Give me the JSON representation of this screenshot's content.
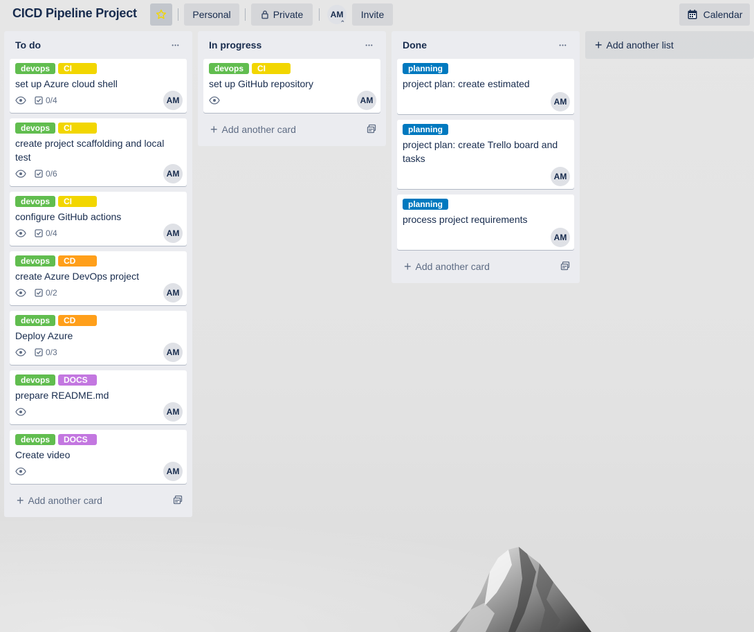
{
  "header": {
    "board_title": "CICD Pipeline Project",
    "personal": "Personal",
    "private": "Private",
    "avatar": "AM",
    "invite": "Invite",
    "calendar": "Calendar"
  },
  "colors": {
    "devops": "#61bd4f",
    "CI": "#f2d600",
    "CD": "#ff9f1a",
    "DOCS": "#c377e0",
    "planning": "#0079bf"
  },
  "lists": [
    {
      "title": "To do",
      "add_card": "Add another card",
      "cards": [
        {
          "labels": [
            "devops",
            "CI"
          ],
          "title": "set up Azure cloud shell",
          "checklist": "0/4",
          "member": "AM"
        },
        {
          "labels": [
            "devops",
            "CI"
          ],
          "title": "create project scaffolding and local test",
          "checklist": "0/6",
          "member": "AM"
        },
        {
          "labels": [
            "devops",
            "CI"
          ],
          "title": "configure GitHub actions",
          "checklist": "0/4",
          "member": "AM"
        },
        {
          "labels": [
            "devops",
            "CD"
          ],
          "title": "create Azure DevOps project",
          "checklist": "0/2",
          "member": "AM"
        },
        {
          "labels": [
            "devops",
            "CD"
          ],
          "title": "Deploy Azure",
          "checklist": "0/3",
          "member": "AM"
        },
        {
          "labels": [
            "devops",
            "DOCS"
          ],
          "title": "prepare README.md",
          "checklist": "",
          "member": "AM"
        },
        {
          "labels": [
            "devops",
            "DOCS"
          ],
          "title": "Create video",
          "checklist": "",
          "member": "AM"
        }
      ]
    },
    {
      "title": "In progress",
      "add_card": "Add another card",
      "cards": [
        {
          "labels": [
            "devops",
            "CI"
          ],
          "title": "set up GitHub repository",
          "checklist": "",
          "member": "AM"
        }
      ]
    },
    {
      "title": "Done",
      "add_card": "Add another card",
      "cards": [
        {
          "labels": [
            "planning"
          ],
          "title": "project plan: create estimated",
          "checklist": "",
          "member": "AM"
        },
        {
          "labels": [
            "planning"
          ],
          "title": "project plan: create Trello board and tasks",
          "checklist": "",
          "member": "AM"
        },
        {
          "labels": [
            "planning"
          ],
          "title": "process project requirements",
          "checklist": "",
          "member": "AM"
        }
      ]
    }
  ],
  "add_list": "Add another list",
  "icons": {
    "star": "star-icon",
    "lock": "lock-icon",
    "calendar": "calendar-icon",
    "watch": "eye-icon",
    "checklist": "checkbox-icon",
    "template": "card-template-icon",
    "menu": "more-horizontal-icon"
  }
}
